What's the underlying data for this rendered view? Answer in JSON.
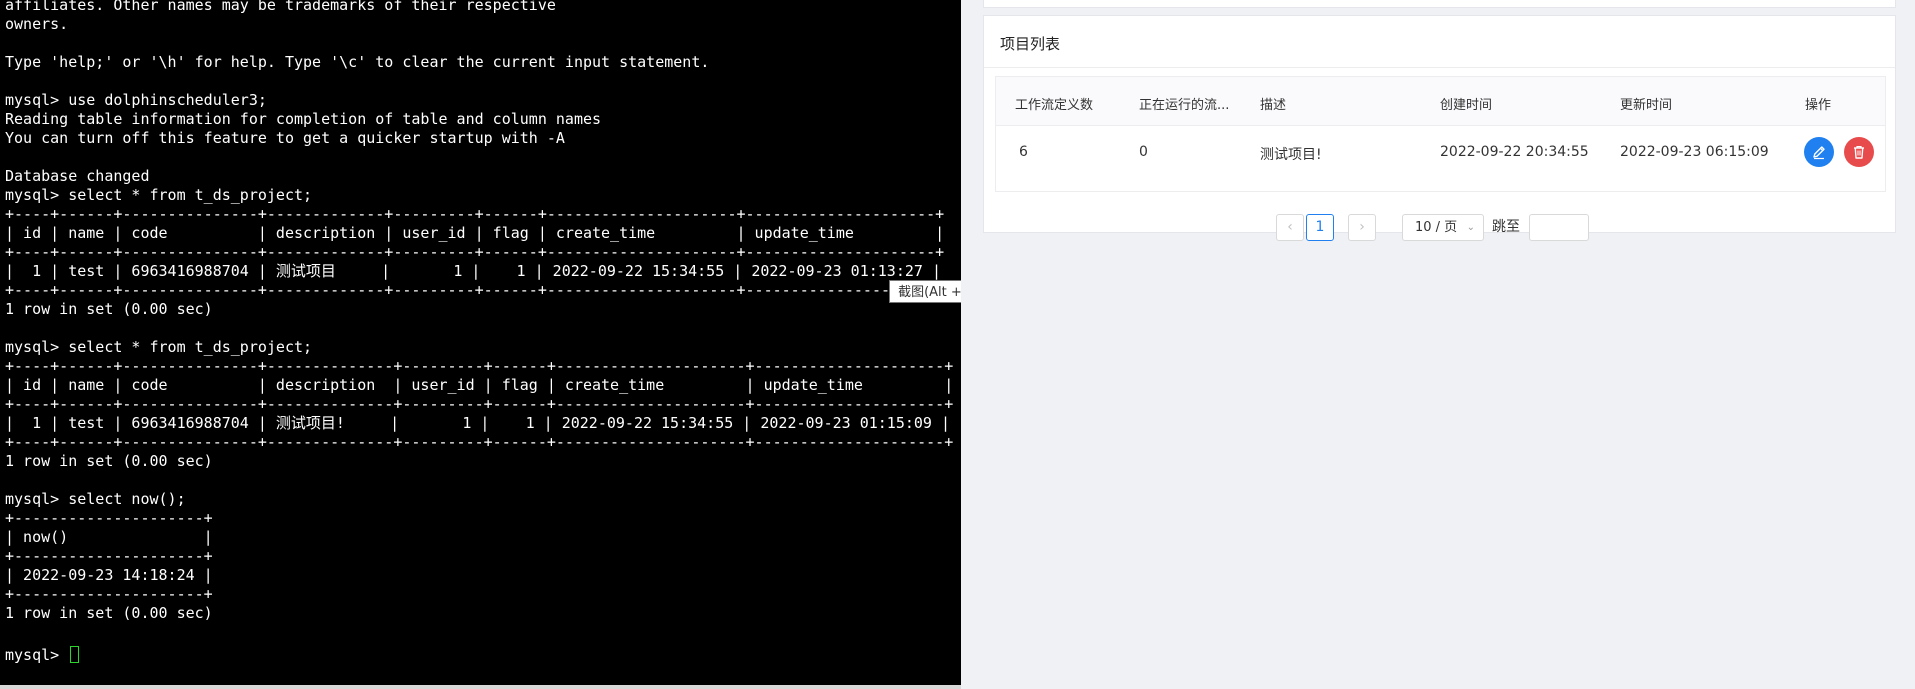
{
  "terminal": {
    "lines": [
      "affiliates. Other names may be trademarks of their respective",
      "owners.",
      "",
      "Type 'help;' or '\\h' for help. Type '\\c' to clear the current input statement.",
      "",
      "mysql> use dolphinscheduler3;",
      "Reading table information for completion of table and column names",
      "You can turn off this feature to get a quicker startup with -A",
      "",
      "Database changed",
      "mysql> select * from t_ds_project;",
      "+----+------+---------------+-------------+---------+------+---------------------+---------------------+",
      "| id | name | code          | description | user_id | flag | create_time         | update_time         |",
      "+----+------+---------------+-------------+---------+------+---------------------+---------------------+",
      "|  1 | test | 6963416988704 | 测试项目     |       1 |    1 | 2022-09-22 15:34:55 | 2022-09-23 01:13:27 |",
      "+----+------+---------------+-------------+---------+------+---------------------+---------------------+",
      "1 row in set (0.00 sec)",
      "",
      "mysql> select * from t_ds_project;",
      "+----+------+---------------+--------------+---------+------+---------------------+---------------------+",
      "| id | name | code          | description  | user_id | flag | create_time         | update_time         |",
      "+----+------+---------------+--------------+---------+------+---------------------+---------------------+",
      "|  1 | test | 6963416988704 | 测试项目!     |       1 |    1 | 2022-09-22 15:34:55 | 2022-09-23 01:15:09 |",
      "+----+------+---------------+--------------+---------+------+---------------------+---------------------+",
      "1 row in set (0.00 sec)",
      "",
      "mysql> select now();",
      "+---------------------+",
      "| now()               |",
      "+---------------------+",
      "| 2022-09-23 14:18:24 |",
      "+---------------------+",
      "1 row in set (0.00 sec)"
    ],
    "prompt": "mysql> ",
    "tooltip": "截图(Alt + A)"
  },
  "project_list": {
    "title": "项目列表",
    "columns": [
      "工作流定义数",
      "正在运行的流...",
      "描述",
      "创建时间",
      "更新时间",
      "操作"
    ],
    "rows": [
      {
        "workflow_count": "6",
        "running_count": "0",
        "description": "测试项目!",
        "create_time": "2022-09-22 20:34:55",
        "update_time": "2022-09-23 06:15:09"
      }
    ],
    "icons": {
      "edit": "edit-pencil-icon",
      "delete": "trash-icon"
    },
    "colors": {
      "edit": "#2080f0",
      "delete": "#e84b4b"
    },
    "pagination": {
      "prev": "‹",
      "current_page": "1",
      "next": "›",
      "page_size": "10 / 页",
      "jump_label": "跳至",
      "jump_value": ""
    }
  }
}
